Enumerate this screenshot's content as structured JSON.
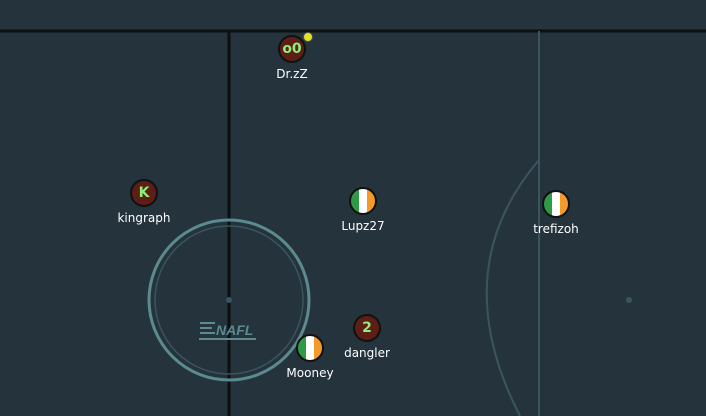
{
  "field": {
    "colors": {
      "background": "#24333c",
      "boundary_line": "#0d0f10",
      "kickoff_circle": "#5b8a8f",
      "arc_line": "#3b555f",
      "logo": "#5b8a8f"
    },
    "logo_text": "NAFL"
  },
  "players": [
    {
      "name": "Dr.zZ",
      "avatar_text": "o0",
      "avatar_style": "red",
      "has_badge": true,
      "badge_color": "#e1e32a"
    },
    {
      "name": "kingraph",
      "avatar_text": "K",
      "avatar_style": "red",
      "has_badge": false
    },
    {
      "name": "Lupz27",
      "avatar_text": "",
      "avatar_style": "flag",
      "has_badge": false
    },
    {
      "name": "trefizoh",
      "avatar_text": "",
      "avatar_style": "flag",
      "has_badge": false
    },
    {
      "name": "dangler",
      "avatar_text": "2",
      "avatar_style": "red",
      "has_badge": false
    },
    {
      "name": "Mooney",
      "avatar_text": "",
      "avatar_style": "flag",
      "has_badge": false
    }
  ],
  "team_colors": {
    "red": "#5d1e16",
    "green": "#2f9a45",
    "white": "#ffffff",
    "orange": "#f39a2b",
    "avatar_text": "#8cf07a"
  }
}
